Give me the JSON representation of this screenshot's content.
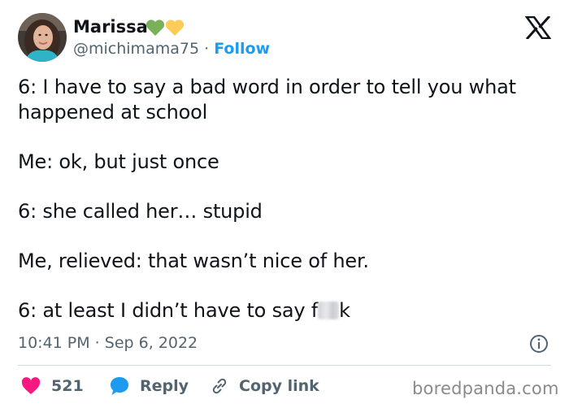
{
  "author": {
    "name": "Marissa",
    "handle": "@michimama75",
    "separator": "·",
    "follow_label": "Follow",
    "emoji_colors": [
      "#78b159",
      "#fdcb58"
    ]
  },
  "tweet": {
    "lines": [
      "6: I have to say a bad word in order to tell you what happened at school",
      "Me: ok, but just once",
      "6: she called her… stupid",
      "Me, relieved: that wasn’t nice of her."
    ],
    "last_line_start": "6: at least I didn’t have to say f",
    "last_line_end": "k"
  },
  "meta": {
    "timestamp": "10:41 PM · Sep 6, 2022"
  },
  "actions": {
    "likes_count": "521",
    "reply_label": "Reply",
    "copy_link_label": "Copy link"
  },
  "watermark": "boredpanda.com",
  "colors": {
    "accent": "#1d9bf0",
    "like": "#f91880",
    "muted": "#536471",
    "text": "#0f1419"
  }
}
